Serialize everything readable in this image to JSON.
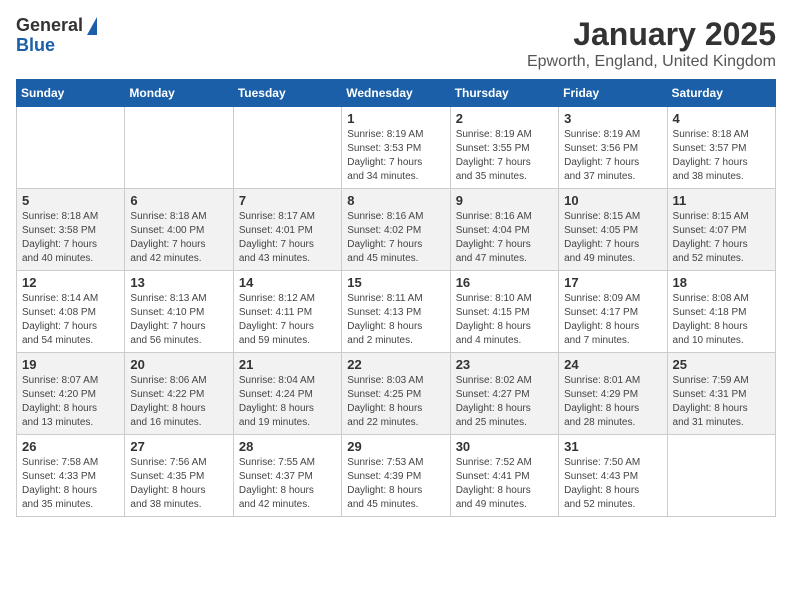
{
  "logo": {
    "general": "General",
    "blue": "Blue"
  },
  "title": "January 2025",
  "location": "Epworth, England, United Kingdom",
  "days_of_week": [
    "Sunday",
    "Monday",
    "Tuesday",
    "Wednesday",
    "Thursday",
    "Friday",
    "Saturday"
  ],
  "weeks": [
    [
      {
        "day": "",
        "info": ""
      },
      {
        "day": "",
        "info": ""
      },
      {
        "day": "",
        "info": ""
      },
      {
        "day": "1",
        "info": "Sunrise: 8:19 AM\nSunset: 3:53 PM\nDaylight: 7 hours\nand 34 minutes."
      },
      {
        "day": "2",
        "info": "Sunrise: 8:19 AM\nSunset: 3:55 PM\nDaylight: 7 hours\nand 35 minutes."
      },
      {
        "day": "3",
        "info": "Sunrise: 8:19 AM\nSunset: 3:56 PM\nDaylight: 7 hours\nand 37 minutes."
      },
      {
        "day": "4",
        "info": "Sunrise: 8:18 AM\nSunset: 3:57 PM\nDaylight: 7 hours\nand 38 minutes."
      }
    ],
    [
      {
        "day": "5",
        "info": "Sunrise: 8:18 AM\nSunset: 3:58 PM\nDaylight: 7 hours\nand 40 minutes."
      },
      {
        "day": "6",
        "info": "Sunrise: 8:18 AM\nSunset: 4:00 PM\nDaylight: 7 hours\nand 42 minutes."
      },
      {
        "day": "7",
        "info": "Sunrise: 8:17 AM\nSunset: 4:01 PM\nDaylight: 7 hours\nand 43 minutes."
      },
      {
        "day": "8",
        "info": "Sunrise: 8:16 AM\nSunset: 4:02 PM\nDaylight: 7 hours\nand 45 minutes."
      },
      {
        "day": "9",
        "info": "Sunrise: 8:16 AM\nSunset: 4:04 PM\nDaylight: 7 hours\nand 47 minutes."
      },
      {
        "day": "10",
        "info": "Sunrise: 8:15 AM\nSunset: 4:05 PM\nDaylight: 7 hours\nand 49 minutes."
      },
      {
        "day": "11",
        "info": "Sunrise: 8:15 AM\nSunset: 4:07 PM\nDaylight: 7 hours\nand 52 minutes."
      }
    ],
    [
      {
        "day": "12",
        "info": "Sunrise: 8:14 AM\nSunset: 4:08 PM\nDaylight: 7 hours\nand 54 minutes."
      },
      {
        "day": "13",
        "info": "Sunrise: 8:13 AM\nSunset: 4:10 PM\nDaylight: 7 hours\nand 56 minutes."
      },
      {
        "day": "14",
        "info": "Sunrise: 8:12 AM\nSunset: 4:11 PM\nDaylight: 7 hours\nand 59 minutes."
      },
      {
        "day": "15",
        "info": "Sunrise: 8:11 AM\nSunset: 4:13 PM\nDaylight: 8 hours\nand 2 minutes."
      },
      {
        "day": "16",
        "info": "Sunrise: 8:10 AM\nSunset: 4:15 PM\nDaylight: 8 hours\nand 4 minutes."
      },
      {
        "day": "17",
        "info": "Sunrise: 8:09 AM\nSunset: 4:17 PM\nDaylight: 8 hours\nand 7 minutes."
      },
      {
        "day": "18",
        "info": "Sunrise: 8:08 AM\nSunset: 4:18 PM\nDaylight: 8 hours\nand 10 minutes."
      }
    ],
    [
      {
        "day": "19",
        "info": "Sunrise: 8:07 AM\nSunset: 4:20 PM\nDaylight: 8 hours\nand 13 minutes."
      },
      {
        "day": "20",
        "info": "Sunrise: 8:06 AM\nSunset: 4:22 PM\nDaylight: 8 hours\nand 16 minutes."
      },
      {
        "day": "21",
        "info": "Sunrise: 8:04 AM\nSunset: 4:24 PM\nDaylight: 8 hours\nand 19 minutes."
      },
      {
        "day": "22",
        "info": "Sunrise: 8:03 AM\nSunset: 4:25 PM\nDaylight: 8 hours\nand 22 minutes."
      },
      {
        "day": "23",
        "info": "Sunrise: 8:02 AM\nSunset: 4:27 PM\nDaylight: 8 hours\nand 25 minutes."
      },
      {
        "day": "24",
        "info": "Sunrise: 8:01 AM\nSunset: 4:29 PM\nDaylight: 8 hours\nand 28 minutes."
      },
      {
        "day": "25",
        "info": "Sunrise: 7:59 AM\nSunset: 4:31 PM\nDaylight: 8 hours\nand 31 minutes."
      }
    ],
    [
      {
        "day": "26",
        "info": "Sunrise: 7:58 AM\nSunset: 4:33 PM\nDaylight: 8 hours\nand 35 minutes."
      },
      {
        "day": "27",
        "info": "Sunrise: 7:56 AM\nSunset: 4:35 PM\nDaylight: 8 hours\nand 38 minutes."
      },
      {
        "day": "28",
        "info": "Sunrise: 7:55 AM\nSunset: 4:37 PM\nDaylight: 8 hours\nand 42 minutes."
      },
      {
        "day": "29",
        "info": "Sunrise: 7:53 AM\nSunset: 4:39 PM\nDaylight: 8 hours\nand 45 minutes."
      },
      {
        "day": "30",
        "info": "Sunrise: 7:52 AM\nSunset: 4:41 PM\nDaylight: 8 hours\nand 49 minutes."
      },
      {
        "day": "31",
        "info": "Sunrise: 7:50 AM\nSunset: 4:43 PM\nDaylight: 8 hours\nand 52 minutes."
      },
      {
        "day": "",
        "info": ""
      }
    ]
  ]
}
